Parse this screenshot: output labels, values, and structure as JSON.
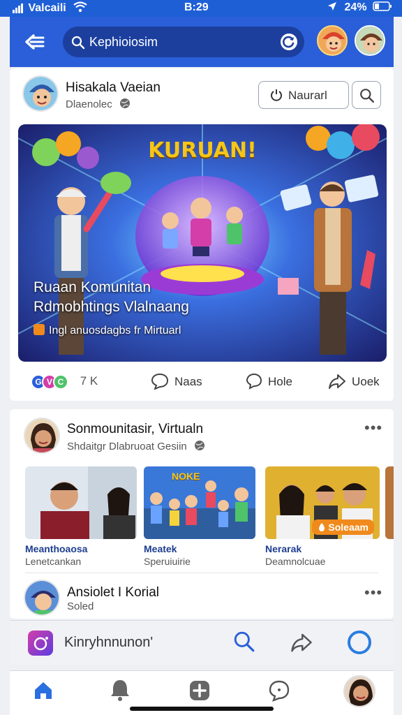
{
  "status_bar": {
    "carrier": "Valcaili",
    "time": "B:29",
    "battery": "24%"
  },
  "header": {
    "search_text": "Kephioiosim"
  },
  "post1": {
    "author": "Hisakala Vaeian",
    "subtitle": "Dlaenolec",
    "follow_label": "Naurarl",
    "banner": {
      "title": "KURUAN!",
      "headline_line1": "Ruaan Komunitan",
      "headline_line2": "Rdmobhtings Vlalnaang",
      "tagline": "Ingl anuosdagbs fr Mirtuarl"
    },
    "reactions_count": "7 K",
    "actions": [
      {
        "label": "Naas"
      },
      {
        "label": "Hole"
      },
      {
        "label": "Uoek"
      }
    ]
  },
  "post2": {
    "author": "Sonmounitasir, Virtualn",
    "subtitle": "Shdaitgr Dlabruoat Gesiin",
    "thumbs": [
      {
        "title": "Meanthoaosa",
        "subtitle": "Lenetcankan"
      },
      {
        "title": "Meatek",
        "subtitle": "Speruiuirie",
        "badge": "NOKE"
      },
      {
        "title": "Nerarak",
        "subtitle": "Deamnolcuae",
        "badge": "Soleaam"
      }
    ]
  },
  "post3": {
    "author": "Ansiolet I Korial",
    "subtitle": "Soled"
  },
  "composer": {
    "placeholder": "Kinryhnnunon'"
  },
  "colors": {
    "brand_blue": "#2a5fd9",
    "accent_orange": "#f08a1c"
  }
}
